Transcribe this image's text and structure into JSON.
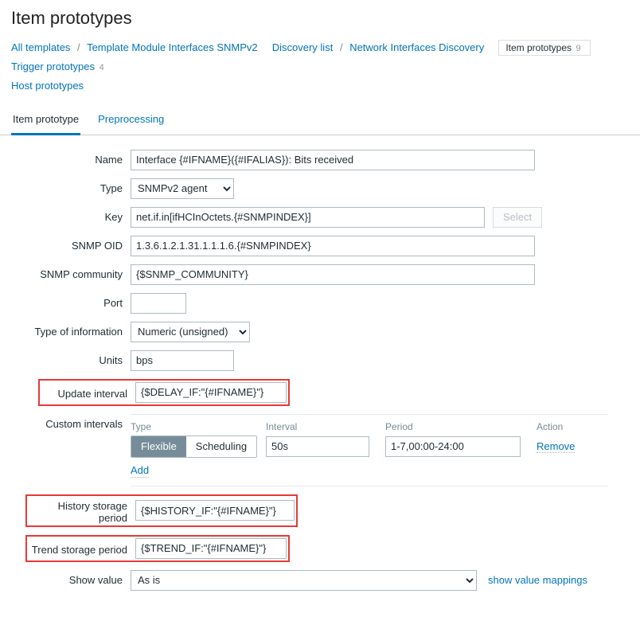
{
  "page_title": "Item prototypes",
  "breadcrumb": {
    "all_templates": "All templates",
    "template": "Template Module Interfaces SNMPv2",
    "discovery_list": "Discovery list",
    "discovery_rule": "Network Interfaces Discovery",
    "item_prototypes": "Item prototypes",
    "item_prototypes_count": "9",
    "trigger_prototypes": "Trigger prototypes",
    "trigger_prototypes_count": "4",
    "host_prototypes": "Host prototypes"
  },
  "tabs": {
    "item_prototype": "Item prototype",
    "preprocessing": "Preprocessing"
  },
  "fields": {
    "name": {
      "label": "Name",
      "value": "Interface {#IFNAME}({#IFALIAS}): Bits received"
    },
    "type": {
      "label": "Type",
      "value": "SNMPv2 agent"
    },
    "key": {
      "label": "Key",
      "value": "net.if.in[ifHCInOctets.{#SNMPINDEX}]",
      "select_btn": "Select"
    },
    "snmp_oid": {
      "label": "SNMP OID",
      "value": "1.3.6.1.2.1.31.1.1.1.6.{#SNMPINDEX}"
    },
    "snmp_community": {
      "label": "SNMP community",
      "value": "{$SNMP_COMMUNITY}"
    },
    "port": {
      "label": "Port",
      "value": ""
    },
    "info_type": {
      "label": "Type of information",
      "value": "Numeric (unsigned)"
    },
    "units": {
      "label": "Units",
      "value": "bps"
    },
    "update_interval": {
      "label": "Update interval",
      "value": "{$DELAY_IF:\"{#IFNAME}\"}"
    },
    "history": {
      "label": "History storage period",
      "value": "{$HISTORY_IF:\"{#IFNAME}\"}"
    },
    "trend": {
      "label": "Trend storage period",
      "value": "{$TREND_IF:\"{#IFNAME}\"}"
    },
    "show_value": {
      "label": "Show value",
      "value": "As is",
      "mappings_link": "show value mappings"
    }
  },
  "custom_intervals": {
    "label": "Custom intervals",
    "header": {
      "type": "Type",
      "interval": "Interval",
      "period": "Period",
      "action": "Action"
    },
    "segmented": {
      "flexible": "Flexible",
      "scheduling": "Scheduling"
    },
    "row": {
      "interval": "50s",
      "period": "1-7,00:00-24:00",
      "remove": "Remove"
    },
    "add": "Add"
  }
}
